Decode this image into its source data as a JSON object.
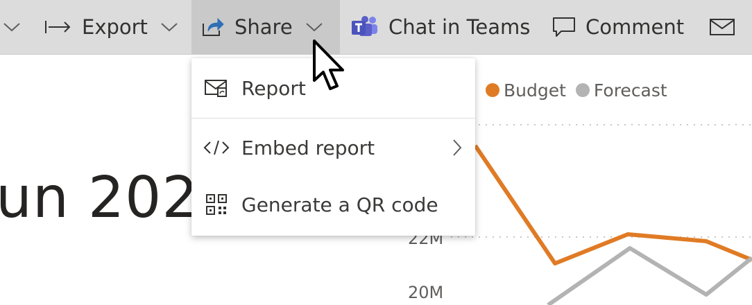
{
  "toolbar": {
    "export_label": "Export",
    "share_label": "Share",
    "chat_label": "Chat in Teams",
    "comment_label": "Comment"
  },
  "canvas": {
    "title_fragment": "un 202"
  },
  "share_menu": {
    "items": [
      {
        "label": "Report",
        "icon": "email-report-icon"
      },
      {
        "label": "Embed report",
        "icon": "code-icon",
        "has_submenu": true
      },
      {
        "label": "Generate a QR code",
        "icon": "qr-code-icon"
      }
    ]
  },
  "chart_data": {
    "type": "line",
    "legend": [
      {
        "name": "Budget",
        "color": "#e07b25"
      },
      {
        "name": "Forecast",
        "color": "#b3b3b3"
      }
    ],
    "y_ticks": [
      "22M",
      "20M"
    ],
    "grid": true,
    "legend_position": "top"
  },
  "colors": {
    "toolbar_bg": "#dcdcdc",
    "budget": "#e07b25",
    "forecast": "#b3b3b3",
    "teams_purple": "#5b5fc7"
  }
}
